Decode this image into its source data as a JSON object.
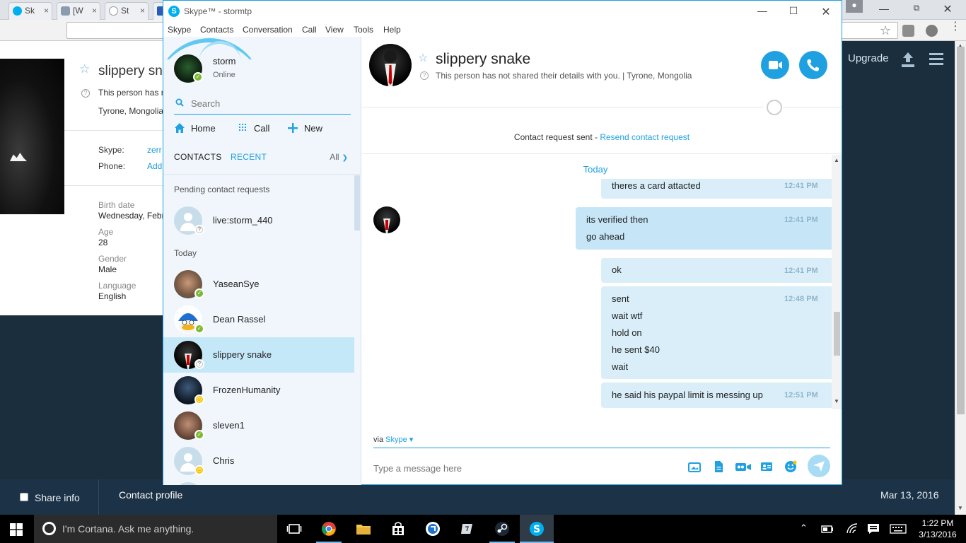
{
  "browser": {
    "tabs": [
      {
        "label": "Sk",
        "color": "#00aff0"
      },
      {
        "label": "[W",
        "color": "#8a9bb0"
      },
      {
        "label": "St",
        "color": "#ffffff"
      },
      {
        "label": "",
        "color": "#2a5bb5"
      }
    ],
    "close_glyph": "×"
  },
  "bg_profile": {
    "name": "slippery sna",
    "not_shared": "This person has n",
    "location": "Tyrone, Mongolia",
    "skype_label": "Skype:",
    "skype_value": "zerr",
    "phone_label": "Phone:",
    "phone_value": "Add",
    "birth_label": "Birth date",
    "birth_value": "Wednesday, Febr",
    "age_label": "Age",
    "age_value": "28",
    "gender_label": "Gender",
    "gender_value": "Male",
    "language_label": "Language",
    "language_value": "English",
    "upgrade": "Upgrade",
    "share_info": "Share info",
    "contact_profile": "Contact profile",
    "date": "Mar 13, 2016"
  },
  "skype": {
    "title": "Skype™ - stormtp",
    "menu": [
      "Skype",
      "Contacts",
      "Conversation",
      "Call",
      "View",
      "Tools",
      "Help"
    ],
    "me": {
      "name": "storm",
      "status": "Online"
    },
    "search_placeholder": "Search",
    "nav": {
      "home": "Home",
      "call": "Call",
      "new": "New"
    },
    "tabs": {
      "contacts": "CONTACTS",
      "recent": "RECENT",
      "filter": "All"
    },
    "sections": {
      "pending": "Pending contact requests",
      "today": "Today"
    },
    "contacts": [
      {
        "name": "live:storm_440",
        "status": "unknown"
      },
      {
        "name": "YaseanSye",
        "status": "online"
      },
      {
        "name": "Dean Rassel",
        "status": "online"
      },
      {
        "name": "slippery snake",
        "status": "unknown"
      },
      {
        "name": "FrozenHumanity",
        "status": "away"
      },
      {
        "name": "sleven1",
        "status": "online"
      },
      {
        "name": "Chris",
        "status": "away"
      }
    ],
    "conversation": {
      "name": "slippery snake",
      "subtitle": "This person has not shared their details with you.  |  Tyrone, Mongolia",
      "request_text": "Contact request sent - ",
      "request_link": "Resend contact request",
      "date_divider": "Today",
      "messages": [
        {
          "lines": [
            "theres a card attacted"
          ],
          "time": "12:41 PM"
        },
        {
          "lines": [
            "its verified then",
            "go ahead"
          ],
          "time": "12:41 PM"
        },
        {
          "lines": [
            "ok"
          ],
          "time": "12:41 PM"
        },
        {
          "lines": [
            "sent",
            "wait wtf",
            "hold on",
            "he sent $40",
            "wait"
          ],
          "time": "12:48 PM"
        },
        {
          "lines": [
            "he said his paypal limit is messing up"
          ],
          "time": "12:51 PM"
        }
      ],
      "via_label": "via ",
      "via_value": "Skype",
      "compose_placeholder": "Type a message here"
    }
  },
  "taskbar": {
    "cortana": "I'm Cortana. Ask me anything.",
    "time": "1:22 PM",
    "date": "3/13/2016"
  },
  "colors": {
    "accent": "#1fa0e0",
    "online": "#7cb830",
    "away": "#f8c300"
  }
}
